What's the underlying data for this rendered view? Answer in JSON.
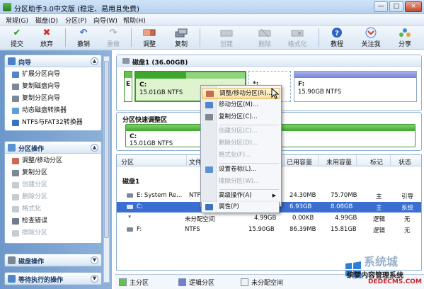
{
  "window": {
    "title": "分区助手3.0中文版 (稳定、易用且免费)",
    "buttons": {
      "minimize": "—",
      "maximize": "□",
      "close": "×"
    }
  },
  "menu": [
    "常规(G)",
    "磁盘(D)",
    "分区(P)",
    "向导(W)",
    "帮助(H)"
  ],
  "toolbar": [
    {
      "label": "提交",
      "icon": "check-icon",
      "disabled": false
    },
    {
      "label": "放弃",
      "icon": "x-icon",
      "disabled": false
    },
    {
      "label": "撤销",
      "icon": "undo-icon",
      "disabled": false
    },
    {
      "label": "重做",
      "icon": "redo-icon",
      "disabled": true
    },
    {
      "label": "调整",
      "icon": "resize-icon",
      "disabled": false
    },
    {
      "label": "复制",
      "icon": "copy-icon",
      "disabled": false
    },
    {
      "label": "创建",
      "icon": "create-icon",
      "disabled": true
    },
    {
      "label": "删除",
      "icon": "delete-icon",
      "disabled": true
    },
    {
      "label": "格式化",
      "icon": "format-icon",
      "disabled": true
    },
    {
      "label": "教程",
      "icon": "help-icon",
      "disabled": false
    },
    {
      "label": "关注我",
      "icon": "follow-icon",
      "disabled": false
    },
    {
      "label": "分享",
      "icon": "share-icon",
      "disabled": false
    }
  ],
  "sidebar": {
    "wizard": {
      "title": "向导",
      "items": [
        "扩展分区向导",
        "复制磁盘向导",
        "复制分区向导",
        "动态磁盘转换器",
        "NTFS与FAT32转换器"
      ]
    },
    "partition_ops": {
      "title": "分区操作",
      "items": [
        {
          "label": "调整/移动分区",
          "disabled": false
        },
        {
          "label": "复制分区",
          "disabled": false
        },
        {
          "label": "创建分区",
          "disabled": true
        },
        {
          "label": "删除分区",
          "disabled": true
        },
        {
          "label": "格式化",
          "disabled": true
        },
        {
          "label": "检查错误",
          "disabled": false
        },
        {
          "label": "擦除分区",
          "disabled": true
        }
      ]
    },
    "disk_ops": {
      "title": "磁盘操作"
    },
    "pending": {
      "title": "等待执行的操作"
    }
  },
  "disk_map": {
    "disk_label": "磁盘1 (36.00GB)",
    "partitions": [
      {
        "label": "E",
        "size": "",
        "type": "primary"
      },
      {
        "label": "C:",
        "size": "15.01GB NTFS",
        "type": "primary",
        "selected": true
      },
      {
        "label": "*:",
        "size": "",
        "type": "unallocated"
      },
      {
        "label": "F:",
        "size": "15.90GB NTFS",
        "type": "logical"
      }
    ]
  },
  "quick_adjust": {
    "title": "分区快速调整区",
    "partition_label": "C:",
    "partition_size": "15.01GB NTFS",
    "used_fraction": 1.0
  },
  "table": {
    "columns": [
      "分区",
      "文件",
      "容量",
      "已用容量",
      "未用容量",
      "标记",
      "状态"
    ],
    "disk_label": "磁盘1",
    "rows": [
      {
        "name": "E: System Re...",
        "fs": "NTFS",
        "capacity": "",
        "used": "24.30MB",
        "unused": "75.70MB",
        "flag": "主",
        "status": "引导",
        "selected": false
      },
      {
        "name": "C:",
        "fs": "",
        "capacity": "",
        "used": "6.93GB",
        "unused": "8.08GB",
        "flag": "主",
        "status": "系统",
        "selected": true
      },
      {
        "name": "*",
        "fs": "未分配空间",
        "capacity": "4.99GB",
        "used": "0.00KB",
        "unused": "4.99GB",
        "flag": "逻辑",
        "status": "无",
        "selected": false
      },
      {
        "name": "F:",
        "fs": "NTFS",
        "capacity": "15.90GB",
        "used": "86.39MB",
        "unused": "15.81GB",
        "flag": "逻辑",
        "status": "无",
        "selected": false
      }
    ]
  },
  "legend": [
    {
      "label": "主分区",
      "color": "#62c44c"
    },
    {
      "label": "逻辑分区",
      "color": "#6f7fd6"
    },
    {
      "label": "未分配空间",
      "color": "#f2f2f2"
    }
  ],
  "context_menu": [
    {
      "label": "调整/移动分区(R)...",
      "disabled": false,
      "highlight": true,
      "icon": "resize-icon"
    },
    {
      "label": "移动分区(M)...",
      "disabled": false,
      "icon": "move-icon"
    },
    {
      "label": "复制分区(C)...",
      "disabled": false,
      "icon": "copy-icon"
    },
    {
      "label": "创建分区(C)...",
      "disabled": true,
      "icon": "create-icon"
    },
    {
      "label": "删除分区(D)...",
      "disabled": true,
      "icon": "delete-icon"
    },
    {
      "label": "格式化(F)...",
      "disabled": true,
      "icon": "format-icon"
    },
    {
      "label": "设置卷标(L)...",
      "disabled": false,
      "icon": "label-icon"
    },
    {
      "label": "擦除分区(W)...",
      "disabled": true,
      "icon": "wipe-icon"
    },
    {
      "label": "高级操作(A)",
      "disabled": false,
      "submenu": true,
      "icon": "advanced-icon"
    },
    {
      "label": "属性(P)",
      "disabled": false,
      "icon": "properties-icon"
    }
  ],
  "watermark": {
    "brand": "系统城",
    "tagline": "织梦内容管理系统",
    "domain": "DEDECMS.COM"
  }
}
